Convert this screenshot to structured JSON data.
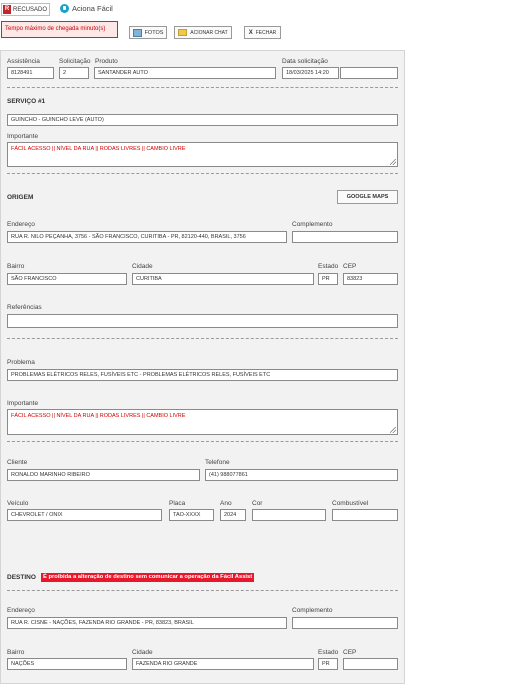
{
  "top": {
    "status_badge_letter": "R",
    "status_label": "RECUSADO",
    "app_name": "Aciona Fácil",
    "alert": "Tempo máximo de chegada minuto(s)",
    "photos_label": "FOTOS",
    "chat_label": "ACIONAR CHAT",
    "close_x": "X",
    "close_label": "FECHAR"
  },
  "header_fields": {
    "assistencia_label": "Assistência",
    "assistencia_value": "8128491",
    "solicitacao_label": "Solicitação",
    "solicitacao_value": "2",
    "produto_label": "Produto",
    "produto_value": "SANTANDER AUTO",
    "data_label": "Data solicitação",
    "data_value": "18/03/2025 14:20",
    "extra_value": ""
  },
  "servico": {
    "title": "SERVIÇO #1",
    "value": "GUINCHO - GUINCHO LEVE (AUTO)",
    "importante_label": "Importante",
    "importante_value": "FÁCIL ACESSO || NÍVEL DA RUA || RODAS LIVRES || CAMBIO LIVRE"
  },
  "origem": {
    "title": "ORIGEM",
    "maps_button": "GOOGLE MAPS",
    "endereco_label": "Endereço",
    "endereco_value": "RUA R. NILO PEÇANHA, 3756 - SÃO FRANCISCO, CURITIBA - PR, 82120-440, BRASIL, 3756",
    "complemento_label": "Complemento",
    "complemento_value": "",
    "bairro_label": "Bairro",
    "bairro_value": "SÃO FRANCISCO",
    "cidade_label": "Cidade",
    "cidade_value": "CURITIBA",
    "estado_label": "Estado",
    "estado_value": "PR",
    "cep_label": "CEP",
    "cep_value": "83823",
    "referencias_label": "Referências",
    "referencias_value": ""
  },
  "problema": {
    "label": "Problema",
    "value": "PROBLEMAS ELÉTRICOS RELES, FUSÍVEIS ETC - PROBLEMAS ELÉTRICOS RELES, FUSÍVEIS ETC",
    "importante_label": "Importante",
    "importante_value": "FÁCIL ACESSO || NÍVEL DA RUA || RODAS LIVRES || CAMBIO LIVRE"
  },
  "cliente": {
    "cliente_label": "Cliente",
    "cliente_value": "RONALDO MARINHO RIBEIRO",
    "telefone_label": "Telefone",
    "telefone_value": "(41) 988077861"
  },
  "veiculo": {
    "veiculo_label": "Veículo",
    "veiculo_value": "CHEVROLET / ONIX",
    "placa_label": "Placa",
    "placa_value": "TAO-XXXX",
    "ano_label": "Ano",
    "ano_value": "2024",
    "cor_label": "Cor",
    "cor_value": "",
    "combustivel_label": "Combustível",
    "combustivel_value": ""
  },
  "destino": {
    "title": "DESTINO",
    "warning": "É proibida a alteração de destino sem comunicar a operação da Fácil Assist",
    "endereco_label": "Endereço",
    "endereco_value": "RUA R. CISNE - NAÇÕES, FAZENDA RIO GRANDE - PR, 83823, BRASIL",
    "complemento_label": "Complemento",
    "complemento_value": "",
    "bairro_label": "Bairro",
    "bairro_value": "NAÇÕES",
    "cidade_label": "Cidade",
    "cidade_value": "FAZENDA RIO GRANDE",
    "estado_label": "Estado",
    "estado_value": "PR",
    "cep_label": "CEP",
    "cep_value": ""
  },
  "colors": {
    "panel_bg": "#f2f2f2",
    "alert_red": "#e8172b",
    "status_red": "#c0272d",
    "logo_teal": "#1aa1c7"
  }
}
